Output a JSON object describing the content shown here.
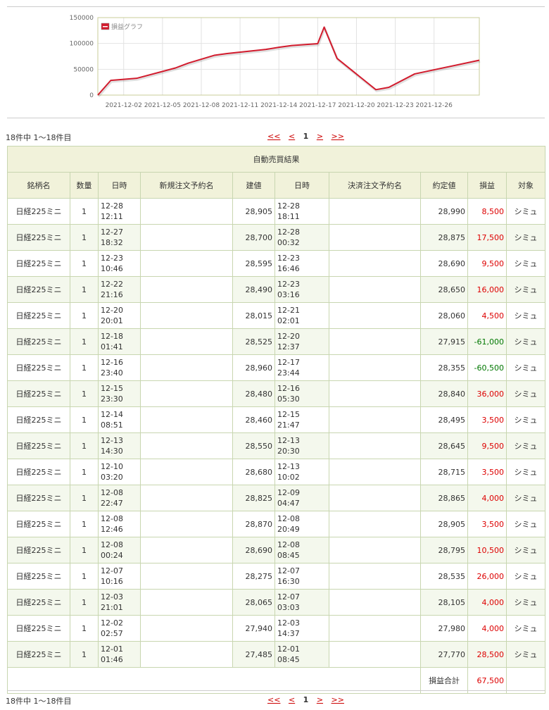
{
  "chart_data": {
    "type": "line",
    "legend": "損益グラフ",
    "series": [
      {
        "name": "損益グラフ",
        "color": "#d21c2e",
        "values": [
          [
            0,
            0
          ],
          [
            1,
            28500
          ],
          [
            3,
            32500
          ],
          [
            6,
            52500
          ],
          [
            7,
            62000
          ],
          [
            9,
            77000
          ],
          [
            10,
            80500
          ],
          [
            13,
            88500
          ],
          [
            14,
            92500
          ],
          [
            15,
            96000
          ],
          [
            17,
            99500
          ],
          [
            17.5,
            131500
          ],
          [
            18.5,
            71000
          ],
          [
            21.5,
            10500
          ],
          [
            22.5,
            15000
          ],
          [
            24.5,
            41000
          ],
          [
            29.5,
            67500
          ]
        ]
      }
    ],
    "x_ticks": [
      {
        "x": 2,
        "label": "2021-12-02"
      },
      {
        "x": 5,
        "label": "2021-12-05"
      },
      {
        "x": 8,
        "label": "2021-12-08"
      },
      {
        "x": 11,
        "label": "2021-12-11"
      },
      {
        "x": 14,
        "label": "2021-12-14"
      },
      {
        "x": 17,
        "label": "2021-12-17"
      },
      {
        "x": 20,
        "label": "2021-12-20"
      },
      {
        "x": 23,
        "label": "2021-12-23"
      },
      {
        "x": 26,
        "label": "2021-12-26"
      }
    ],
    "xlim": [
      0,
      29.5
    ],
    "y_ticks": [
      0,
      50000,
      100000,
      150000
    ],
    "ylim": [
      0,
      150000
    ],
    "grid": true,
    "legend_position": "top-left"
  },
  "pagination": {
    "info": "18件中 1〜18件目",
    "first": "<<",
    "prev": "<",
    "current": "1",
    "next": ">",
    "last": ">>"
  },
  "table": {
    "caption": "自動売買結果",
    "headers": [
      "銘柄名",
      "数量",
      "日時",
      "新規注文予約名",
      "建値",
      "日時",
      "決済注文予約名",
      "約定値",
      "損益",
      "対象"
    ],
    "rows": [
      {
        "name": "日経225ミニ",
        "qty": "1",
        "open_dt": "12-28\n12:11",
        "open_price": "28,905",
        "close_dt": "12-28\n18:11",
        "close_price": "28,990",
        "pl": "8,500",
        "target": "シミュ"
      },
      {
        "name": "日経225ミニ",
        "qty": "1",
        "open_dt": "12-27\n18:32",
        "open_price": "28,700",
        "close_dt": "12-28\n00:32",
        "close_price": "28,875",
        "pl": "17,500",
        "target": "シミュ"
      },
      {
        "name": "日経225ミニ",
        "qty": "1",
        "open_dt": "12-23\n10:46",
        "open_price": "28,595",
        "close_dt": "12-23\n16:46",
        "close_price": "28,690",
        "pl": "9,500",
        "target": "シミュ"
      },
      {
        "name": "日経225ミニ",
        "qty": "1",
        "open_dt": "12-22\n21:16",
        "open_price": "28,490",
        "close_dt": "12-23\n03:16",
        "close_price": "28,650",
        "pl": "16,000",
        "target": "シミュ"
      },
      {
        "name": "日経225ミニ",
        "qty": "1",
        "open_dt": "12-20\n20:01",
        "open_price": "28,015",
        "close_dt": "12-21\n02:01",
        "close_price": "28,060",
        "pl": "4,500",
        "target": "シミュ"
      },
      {
        "name": "日経225ミニ",
        "qty": "1",
        "open_dt": "12-18\n01:41",
        "open_price": "28,525",
        "close_dt": "12-20\n12:37",
        "close_price": "27,915",
        "pl": "-61,000",
        "target": "シミュ"
      },
      {
        "name": "日経225ミニ",
        "qty": "1",
        "open_dt": "12-16\n23:40",
        "open_price": "28,960",
        "close_dt": "12-17\n23:44",
        "close_price": "28,355",
        "pl": "-60,500",
        "target": "シミュ"
      },
      {
        "name": "日経225ミニ",
        "qty": "1",
        "open_dt": "12-15\n23:30",
        "open_price": "28,480",
        "close_dt": "12-16\n05:30",
        "close_price": "28,840",
        "pl": "36,000",
        "target": "シミュ"
      },
      {
        "name": "日経225ミニ",
        "qty": "1",
        "open_dt": "12-14\n08:51",
        "open_price": "28,460",
        "close_dt": "12-15\n21:47",
        "close_price": "28,495",
        "pl": "3,500",
        "target": "シミュ"
      },
      {
        "name": "日経225ミニ",
        "qty": "1",
        "open_dt": "12-13\n14:30",
        "open_price": "28,550",
        "close_dt": "12-13\n20:30",
        "close_price": "28,645",
        "pl": "9,500",
        "target": "シミュ"
      },
      {
        "name": "日経225ミニ",
        "qty": "1",
        "open_dt": "12-10\n03:20",
        "open_price": "28,680",
        "close_dt": "12-13\n10:02",
        "close_price": "28,715",
        "pl": "3,500",
        "target": "シミュ"
      },
      {
        "name": "日経225ミニ",
        "qty": "1",
        "open_dt": "12-08\n22:47",
        "open_price": "28,825",
        "close_dt": "12-09\n04:47",
        "close_price": "28,865",
        "pl": "4,000",
        "target": "シミュ"
      },
      {
        "name": "日経225ミニ",
        "qty": "1",
        "open_dt": "12-08\n12:46",
        "open_price": "28,870",
        "close_dt": "12-08\n20:49",
        "close_price": "28,905",
        "pl": "3,500",
        "target": "シミュ"
      },
      {
        "name": "日経225ミニ",
        "qty": "1",
        "open_dt": "12-08\n00:24",
        "open_price": "28,690",
        "close_dt": "12-08\n08:45",
        "close_price": "28,795",
        "pl": "10,500",
        "target": "シミュ"
      },
      {
        "name": "日経225ミニ",
        "qty": "1",
        "open_dt": "12-07\n10:16",
        "open_price": "28,275",
        "close_dt": "12-07\n16:30",
        "close_price": "28,535",
        "pl": "26,000",
        "target": "シミュ"
      },
      {
        "name": "日経225ミニ",
        "qty": "1",
        "open_dt": "12-03\n21:01",
        "open_price": "28,065",
        "close_dt": "12-07\n03:03",
        "close_price": "28,105",
        "pl": "4,000",
        "target": "シミュ"
      },
      {
        "name": "日経225ミニ",
        "qty": "1",
        "open_dt": "12-02\n02:57",
        "open_price": "27,940",
        "close_dt": "12-03\n14:37",
        "close_price": "27,980",
        "pl": "4,000",
        "target": "シミュ"
      },
      {
        "name": "日経225ミニ",
        "qty": "1",
        "open_dt": "12-01\n01:46",
        "open_price": "27,485",
        "close_dt": "12-01\n08:45",
        "close_price": "27,770",
        "pl": "28,500",
        "target": "シミュ"
      }
    ],
    "total_label": "損益合計",
    "total_value": "67,500"
  },
  "colors": {
    "positive": "#dd0000",
    "negative": "#007700",
    "header_bg": "#f1f2da",
    "alt_row": "#f4f8ed"
  }
}
